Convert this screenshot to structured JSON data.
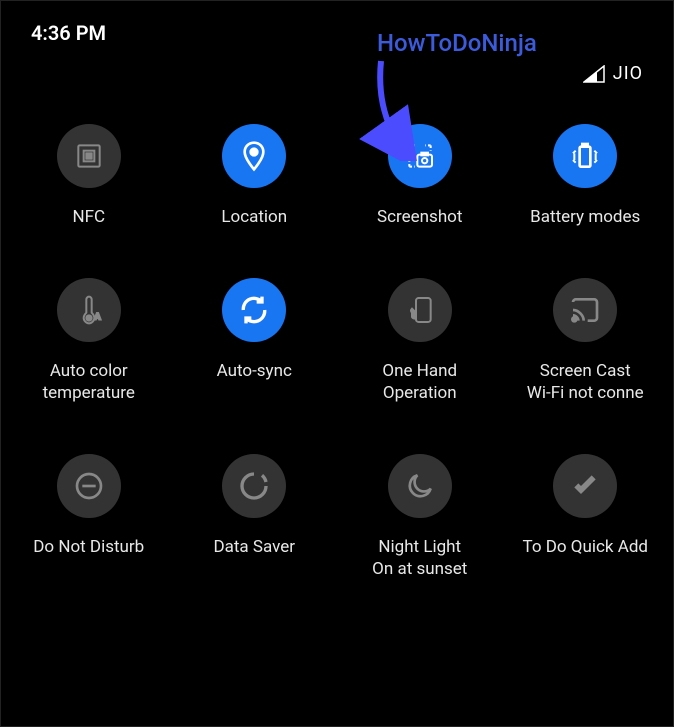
{
  "status": {
    "time": "4:36 PM",
    "carrier": "JIO"
  },
  "annotation": {
    "text": "HowToDoNinja"
  },
  "tiles": [
    {
      "label": "NFC",
      "icon": "nfc-icon",
      "active": false
    },
    {
      "label": "Location",
      "icon": "location-icon",
      "active": true
    },
    {
      "label": "Screenshot",
      "icon": "screenshot-icon",
      "active": true
    },
    {
      "label": "Battery modes",
      "icon": "battery-icon",
      "active": true
    },
    {
      "label": "Auto color temperature",
      "icon": "thermometer-icon",
      "active": false
    },
    {
      "label": "Auto-sync",
      "icon": "sync-icon",
      "active": true
    },
    {
      "label": "One Hand Operation",
      "icon": "onehand-icon",
      "active": false
    },
    {
      "label": "Screen Cast\nWi-Fi not conne",
      "icon": "cast-icon",
      "active": false
    },
    {
      "label": "Do Not Disturb",
      "icon": "dnd-icon",
      "active": false
    },
    {
      "label": "Data Saver",
      "icon": "datasaver-icon",
      "active": false
    },
    {
      "label": "Night Light\nOn at sunset",
      "icon": "nightlight-icon",
      "active": false
    },
    {
      "label": "To Do Quick Add",
      "icon": "todo-icon",
      "active": false
    }
  ]
}
